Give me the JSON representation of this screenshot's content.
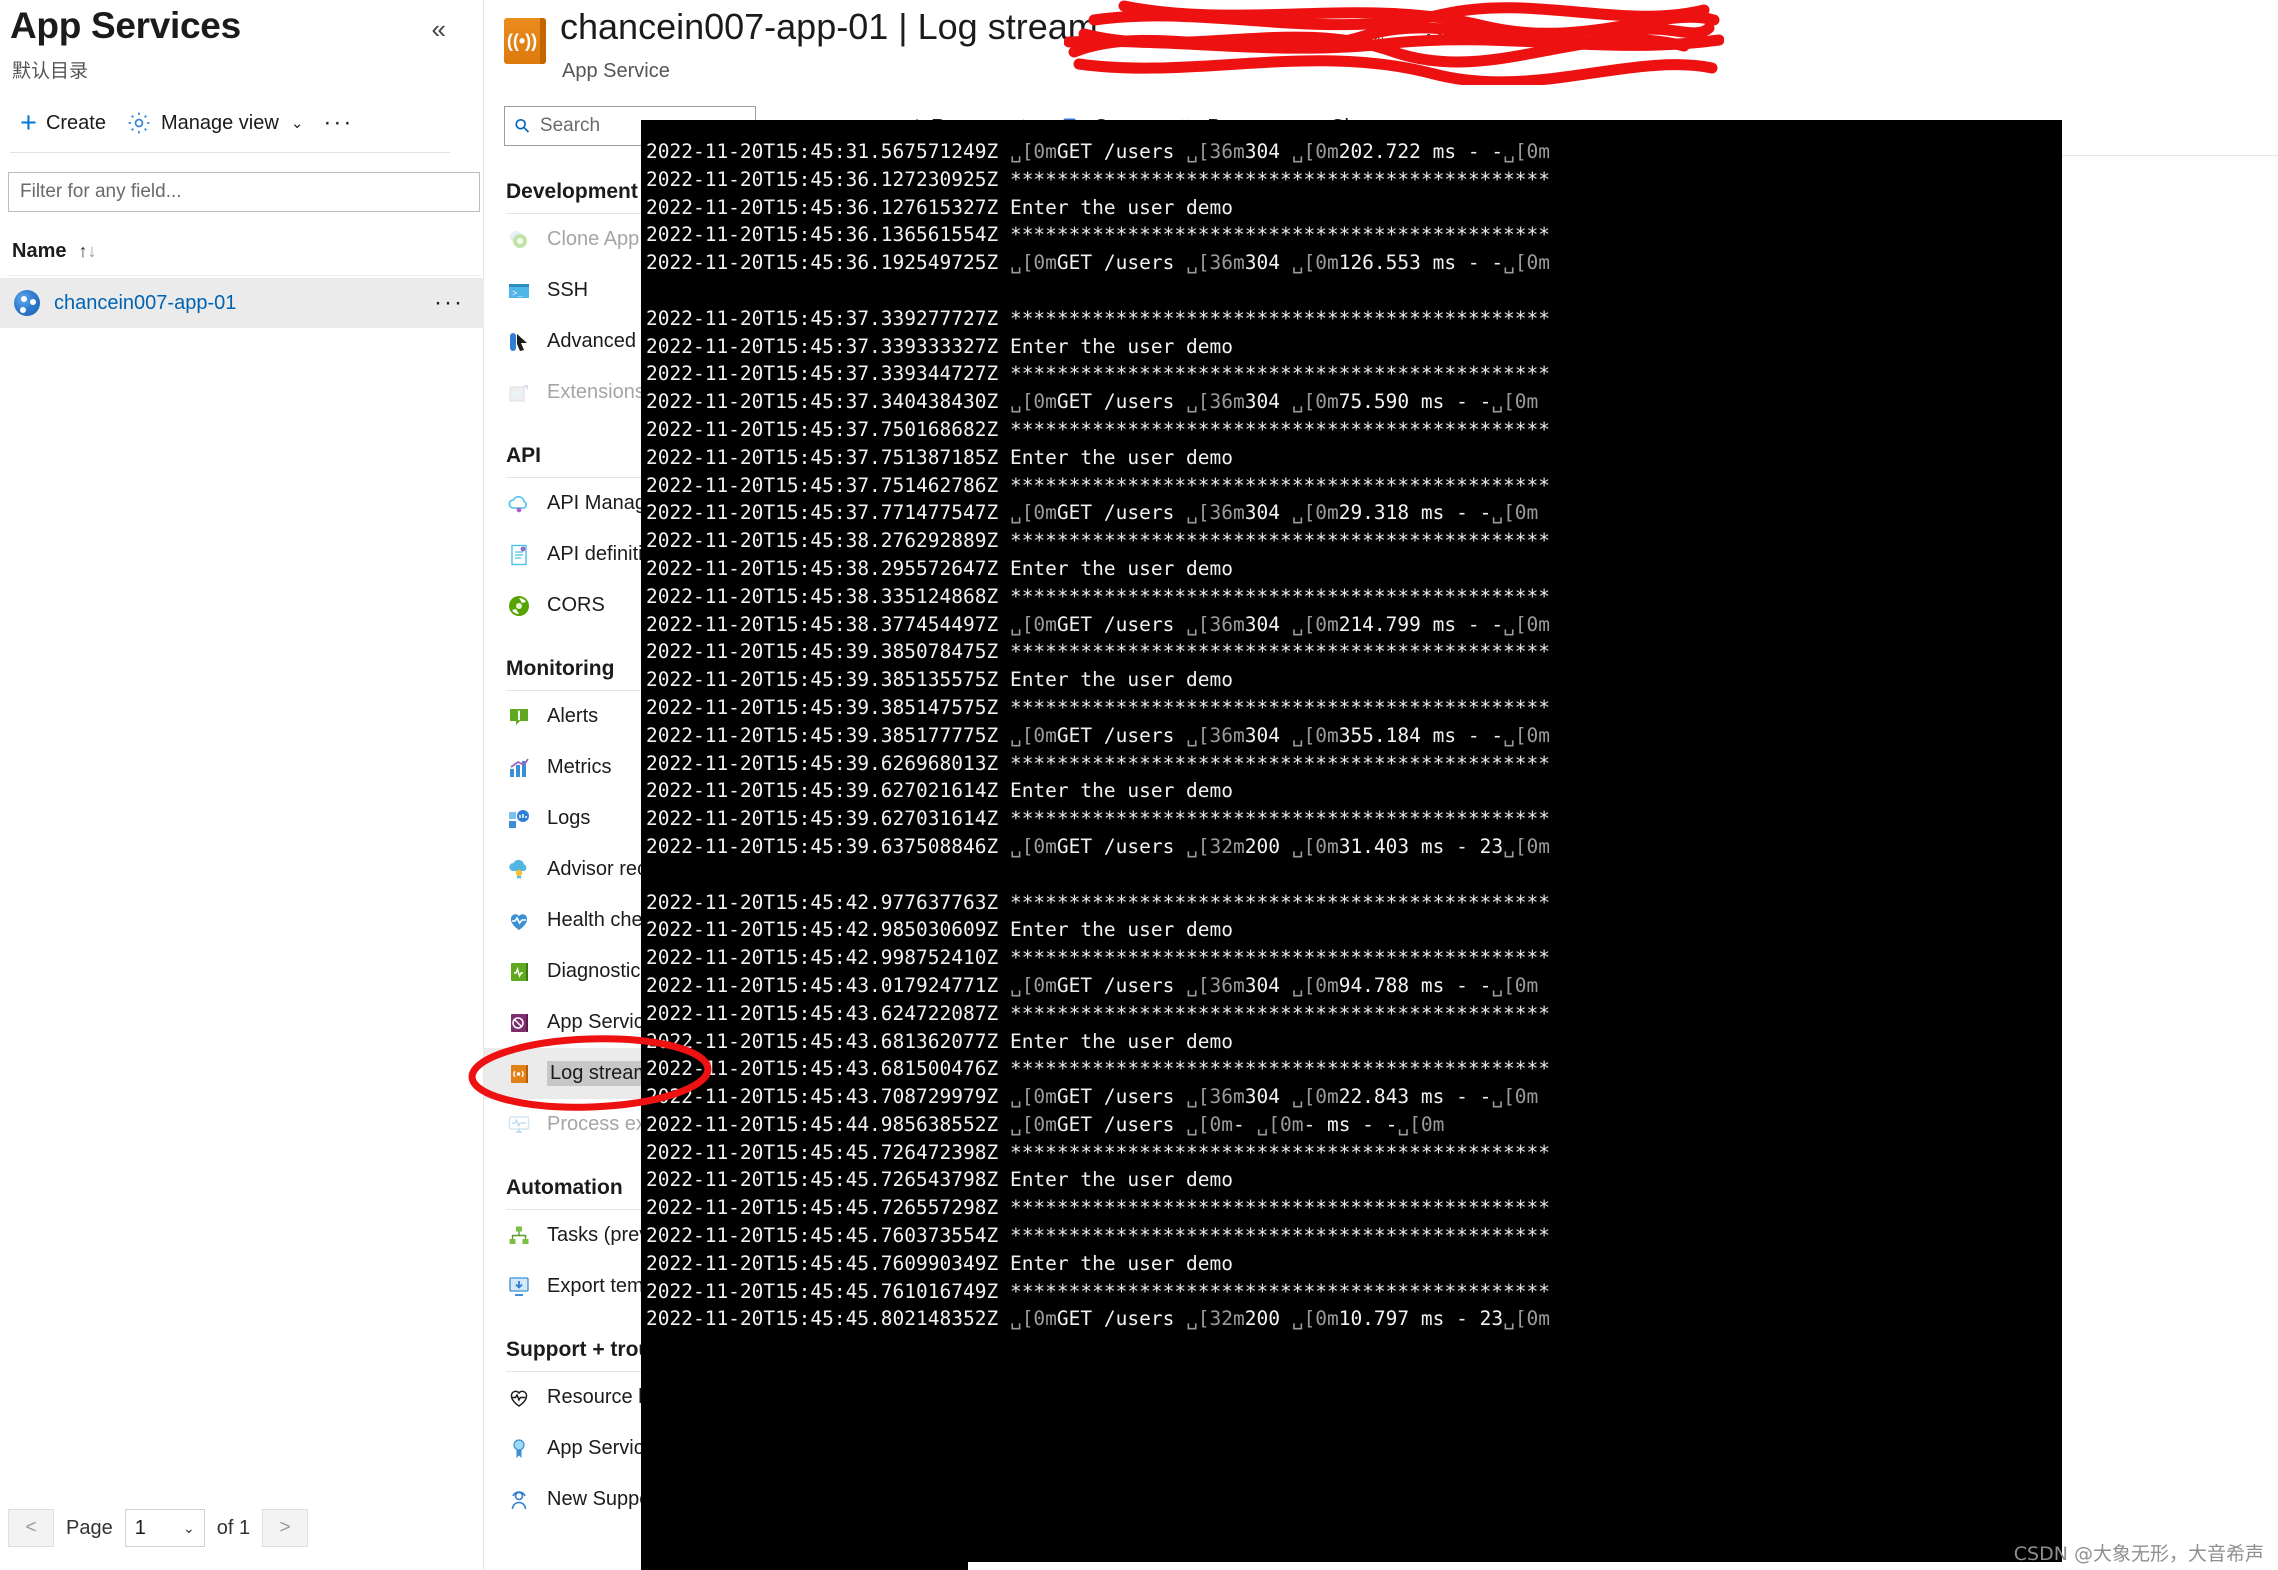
{
  "left_blade": {
    "title": "App Services",
    "subtitle": "默认目录",
    "collapse_icon": "«",
    "commands": {
      "create": "Create",
      "manage_view": "Manage view",
      "more": "···"
    },
    "filter_placeholder": "Filter for any field...",
    "column_header": "Name",
    "rows": [
      {
        "name": "chancein007-app-01"
      }
    ],
    "pager": {
      "prev": "<",
      "label": "Page",
      "value": "1",
      "of": "of 1",
      "next": ">"
    }
  },
  "resource": {
    "title_suffix": "| Log stream",
    "title_redacted": "chancein007-app-01",
    "subtitle": "App Service",
    "star_icon": "☆",
    "more_icon": "···"
  },
  "nav": {
    "search_placeholder": "Search",
    "collapse_icon": "«",
    "groups": [
      {
        "header": "Development Tools",
        "items": [
          {
            "label": "Clone App",
            "icon": "clone-app-icon",
            "state": "disabled"
          },
          {
            "label": "SSH",
            "icon": "ssh-icon",
            "state": "normal"
          },
          {
            "label": "Advanced Tools",
            "icon": "advanced-tools-icon",
            "state": "normal"
          },
          {
            "label": "Extensions",
            "icon": "extensions-icon",
            "state": "disabled"
          }
        ]
      },
      {
        "header": "API",
        "items": [
          {
            "label": "API Management",
            "icon": "api-management-icon",
            "state": "normal"
          },
          {
            "label": "API definition",
            "icon": "api-definition-icon",
            "state": "normal"
          },
          {
            "label": "CORS",
            "icon": "cors-icon",
            "state": "normal"
          }
        ]
      },
      {
        "header": "Monitoring",
        "items": [
          {
            "label": "Alerts",
            "icon": "alerts-icon",
            "state": "normal"
          },
          {
            "label": "Metrics",
            "icon": "metrics-icon",
            "state": "normal"
          },
          {
            "label": "Logs",
            "icon": "logs-icon",
            "state": "normal"
          },
          {
            "label": "Advisor recommendations",
            "icon": "advisor-icon",
            "state": "normal"
          },
          {
            "label": "Health check",
            "icon": "health-check-icon",
            "state": "normal"
          },
          {
            "label": "Diagnostic settings",
            "icon": "diagnostic-settings-icon",
            "state": "normal"
          },
          {
            "label": "App Service logs",
            "icon": "app-service-logs-icon",
            "state": "normal"
          },
          {
            "label": "Log stream",
            "icon": "log-stream-icon",
            "state": "selected"
          },
          {
            "label": "Process explorer",
            "icon": "process-explorer-icon",
            "state": "disabled"
          }
        ]
      },
      {
        "header": "Automation",
        "items": [
          {
            "label": "Tasks (preview)",
            "icon": "tasks-icon",
            "state": "normal"
          },
          {
            "label": "Export template",
            "icon": "export-template-icon",
            "state": "normal"
          }
        ]
      },
      {
        "header": "Support + troubleshooting",
        "items": [
          {
            "label": "Resource health",
            "icon": "resource-health-icon",
            "state": "normal"
          },
          {
            "label": "App Service Advisor",
            "icon": "app-service-advisor-icon",
            "state": "normal"
          },
          {
            "label": "New Support Request",
            "icon": "new-support-request-icon",
            "state": "normal"
          }
        ]
      }
    ]
  },
  "log_toolbar": {
    "reconnect": "Reconnect",
    "copy": "Copy",
    "pause": "Pause",
    "clear": "Clear"
  },
  "console": {
    "lines": [
      "2022-11-20T15:45:31.567571249Z ␣[0mGET /users ␣[36m304 ␣[0m202.722 ms - -␣[0m",
      "2022-11-20T15:45:36.127230925Z **********************************************",
      "2022-11-20T15:45:36.127615327Z Enter the user demo",
      "2022-11-20T15:45:36.136561554Z **********************************************",
      "2022-11-20T15:45:36.192549725Z ␣[0mGET /users ␣[36m304 ␣[0m126.553 ms - -␣[0m",
      "",
      "2022-11-20T15:45:37.339277727Z **********************************************",
      "2022-11-20T15:45:37.339333327Z Enter the user demo",
      "2022-11-20T15:45:37.339344727Z **********************************************",
      "2022-11-20T15:45:37.340438430Z ␣[0mGET /users ␣[36m304 ␣[0m75.590 ms - -␣[0m",
      "2022-11-20T15:45:37.750168682Z **********************************************",
      "2022-11-20T15:45:37.751387185Z Enter the user demo",
      "2022-11-20T15:45:37.751462786Z **********************************************",
      "2022-11-20T15:45:37.771477547Z ␣[0mGET /users ␣[36m304 ␣[0m29.318 ms - -␣[0m",
      "2022-11-20T15:45:38.276292889Z **********************************************",
      "2022-11-20T15:45:38.295572647Z Enter the user demo",
      "2022-11-20T15:45:38.335124868Z **********************************************",
      "2022-11-20T15:45:38.377454497Z ␣[0mGET /users ␣[36m304 ␣[0m214.799 ms - -␣[0m",
      "2022-11-20T15:45:39.385078475Z **********************************************",
      "2022-11-20T15:45:39.385135575Z Enter the user demo",
      "2022-11-20T15:45:39.385147575Z **********************************************",
      "2022-11-20T15:45:39.385177775Z ␣[0mGET /users ␣[36m304 ␣[0m355.184 ms - -␣[0m",
      "2022-11-20T15:45:39.626968013Z **********************************************",
      "2022-11-20T15:45:39.627021614Z Enter the user demo",
      "2022-11-20T15:45:39.627031614Z **********************************************",
      "2022-11-20T15:45:39.637508846Z ␣[0mGET /users ␣[32m200 ␣[0m31.403 ms - 23␣[0m",
      "",
      "2022-11-20T15:45:42.977637763Z **********************************************",
      "2022-11-20T15:45:42.985030609Z Enter the user demo",
      "2022-11-20T15:45:42.998752410Z **********************************************",
      "2022-11-20T15:45:43.017924771Z ␣[0mGET /users ␣[36m304 ␣[0m94.788 ms - -␣[0m",
      "2022-11-20T15:45:43.624722087Z **********************************************",
      "2022-11-20T15:45:43.681362077Z Enter the user demo",
      "2022-11-20T15:45:43.681500476Z **********************************************",
      "2022-11-20T15:45:43.708729979Z ␣[0mGET /users ␣[36m304 ␣[0m22.843 ms - -␣[0m",
      "2022-11-20T15:45:44.985638552Z ␣[0mGET /users ␣[0m- ␣[0m- ms - -␣[0m",
      "2022-11-20T15:45:45.726472398Z **********************************************",
      "2022-11-20T15:45:45.726543798Z Enter the user demo",
      "2022-11-20T15:45:45.726557298Z **********************************************",
      "2022-11-20T15:45:45.760373554Z **********************************************",
      "2022-11-20T15:45:45.760990349Z Enter the user demo",
      "2022-11-20T15:45:45.761016749Z **********************************************",
      "2022-11-20T15:45:45.802148352Z ␣[0mGET /users ␣[32m200 ␣[0m10.797 ms - 23␣[0m"
    ]
  },
  "watermark": "CSDN @大象无形，大音希声",
  "colors": {
    "accent": "#0078d4",
    "link": "#0063b1",
    "toolbar_icon": "#3b6fd4",
    "console_bg": "#000000",
    "console_fg": "#f2f2f2",
    "selected_row": "#ebebeb",
    "redaction": "#ee1111",
    "app_service_orange": "#dd7a0d"
  }
}
